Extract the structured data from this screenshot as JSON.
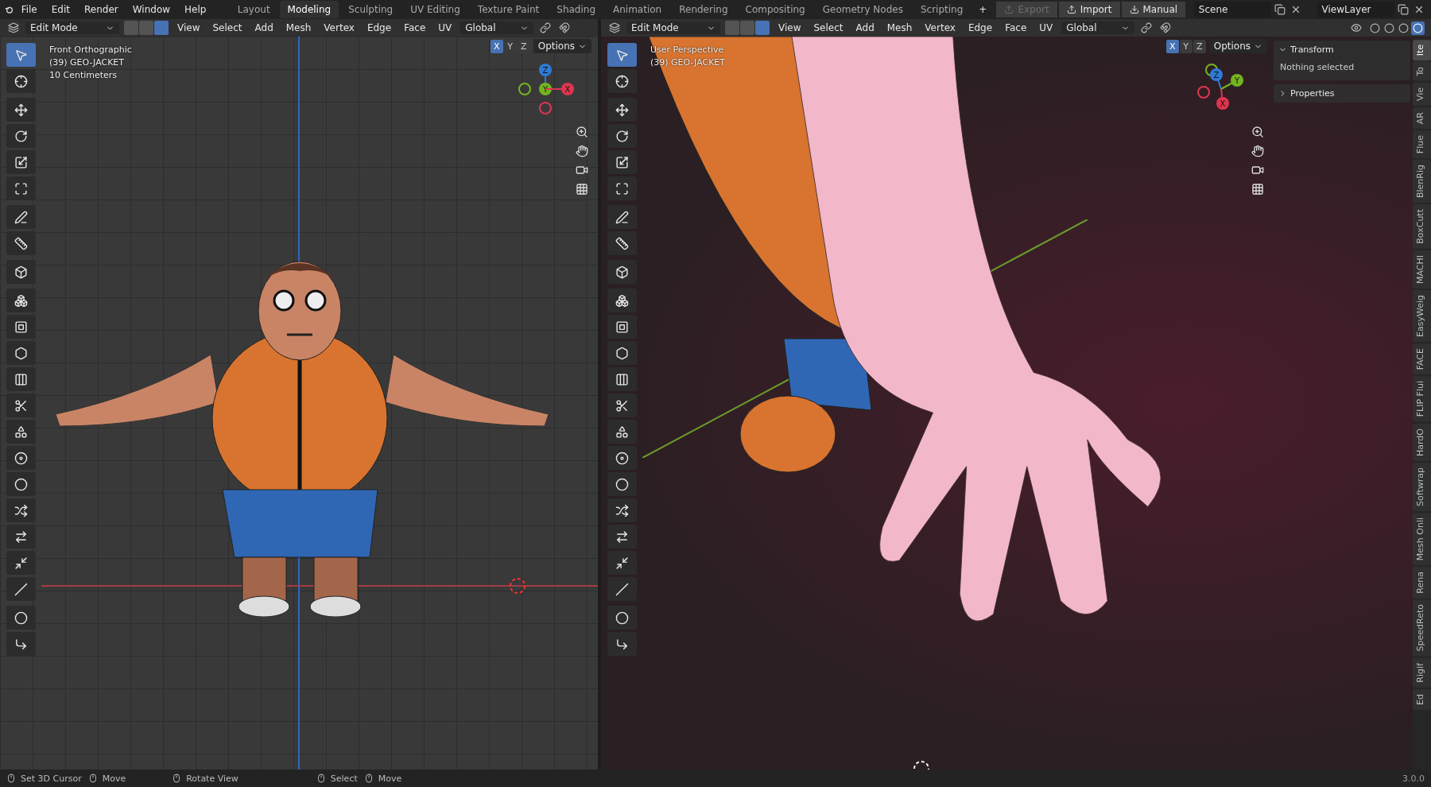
{
  "top_bar": {
    "menus": [
      "File",
      "Edit",
      "Render",
      "Window",
      "Help"
    ],
    "workspace_tabs": [
      {
        "label": "Layout",
        "selected": false
      },
      {
        "label": "Modeling",
        "selected": true
      },
      {
        "label": "Sculpting",
        "selected": false
      },
      {
        "label": "UV Editing",
        "selected": false
      },
      {
        "label": "Texture Paint",
        "selected": false
      },
      {
        "label": "Shading",
        "selected": false
      },
      {
        "label": "Animation",
        "selected": false
      },
      {
        "label": "Rendering",
        "selected": false
      },
      {
        "label": "Compositing",
        "selected": false
      },
      {
        "label": "Geometry Nodes",
        "selected": false
      },
      {
        "label": "Scripting",
        "selected": false
      }
    ],
    "add_tab": "+",
    "buttons": [
      {
        "label": "Export",
        "disabled": true
      },
      {
        "label": "Import",
        "disabled": false
      },
      {
        "label": "Manual",
        "disabled": false
      }
    ],
    "scene": "Scene",
    "view_layer": "ViewLayer"
  },
  "viewports": [
    {
      "header": {
        "mode": "Edit Mode",
        "select_modes": [
          {
            "selected": false
          },
          {
            "selected": false
          },
          {
            "selected": true
          }
        ],
        "menus": [
          "View",
          "Select",
          "Add",
          "Mesh",
          "Vertex",
          "Edge",
          "Face",
          "UV"
        ],
        "orientation": "Global",
        "axes": [
          {
            "label": "X",
            "selected": true
          },
          {
            "label": "Y",
            "selected": false
          },
          {
            "label": "Z",
            "selected": false
          }
        ],
        "options": "Options"
      },
      "overlay_lines": [
        "Front Orthographic",
        "(39) GEO-JACKET",
        "10 Centimeters"
      ],
      "gizmo": {
        "axes": [
          {
            "label": "Z",
            "color": "#2e7bd6"
          },
          {
            "label": "Y",
            "color": "#74b51f"
          },
          {
            "label": "X",
            "color": "#e0354f"
          }
        ]
      },
      "toolbar": [
        {
          "tools": [
            {
              "kind": "select",
              "selected": true
            },
            {
              "kind": "cursor",
              "selected": false
            }
          ]
        },
        {
          "tools": [
            {
              "kind": "move",
              "selected": false
            },
            {
              "kind": "rotate",
              "selected": false
            },
            {
              "kind": "scale",
              "selected": false
            },
            {
              "kind": "transform",
              "selected": false
            }
          ]
        },
        {
          "tools": [
            {
              "kind": "annotate",
              "selected": false
            },
            {
              "kind": "measure",
              "selected": false
            }
          ]
        },
        {
          "tools": [
            {
              "kind": "add_cube",
              "selected": false
            }
          ]
        },
        {
          "tools": [
            {
              "kind": "extrude",
              "selected": false
            },
            {
              "kind": "inset",
              "selected": false
            },
            {
              "kind": "bevel",
              "selected": false
            },
            {
              "kind": "loop_cut",
              "selected": false
            },
            {
              "kind": "knife",
              "selected": false
            },
            {
              "kind": "poly_build",
              "selected": false
            },
            {
              "kind": "spin",
              "selected": false
            },
            {
              "kind": "smooth",
              "selected": false
            },
            {
              "kind": "randomize",
              "selected": false
            },
            {
              "kind": "edge_slide",
              "selected": false
            },
            {
              "kind": "shrink",
              "selected": false
            },
            {
              "kind": "shear",
              "selected": false
            }
          ]
        },
        {
          "tools": [
            {
              "kind": "to_sphere",
              "selected": false
            },
            {
              "kind": "rip",
              "selected": false
            }
          ]
        }
      ]
    },
    {
      "header": {
        "mode": "Edit Mode",
        "select_modes": [
          {
            "selected": false
          },
          {
            "selected": false
          },
          {
            "selected": true
          }
        ],
        "menus": [
          "View",
          "Select",
          "Add",
          "Mesh",
          "Vertex",
          "Edge",
          "Face",
          "UV"
        ],
        "orientation": "Global",
        "axes": [
          {
            "label": "X",
            "selected": true
          },
          {
            "label": "Y",
            "selected": false
          },
          {
            "label": "Z",
            "selected": false
          }
        ],
        "options": "Options",
        "shading": [
          {
            "selected": false
          },
          {
            "selected": false
          },
          {
            "selected": false
          },
          {
            "selected": true
          }
        ]
      },
      "overlay_lines": [
        "User Perspective",
        "(39) GEO-JACKET"
      ],
      "gizmo": {
        "axes": [
          {
            "label": "Z",
            "color": "#2e7bd6"
          },
          {
            "label": "Y",
            "color": "#74b51f"
          },
          {
            "label": "X",
            "color": "#e0354f"
          }
        ]
      },
      "toolbar": [
        {
          "tools": [
            {
              "kind": "select",
              "selected": true
            },
            {
              "kind": "cursor",
              "selected": false
            }
          ]
        },
        {
          "tools": [
            {
              "kind": "move",
              "selected": false
            },
            {
              "kind": "rotate",
              "selected": false
            },
            {
              "kind": "scale",
              "selected": false
            },
            {
              "kind": "transform",
              "selected": false
            }
          ]
        },
        {
          "tools": [
            {
              "kind": "annotate",
              "selected": false
            },
            {
              "kind": "measure",
              "selected": false
            }
          ]
        },
        {
          "tools": [
            {
              "kind": "add_cube",
              "selected": false
            }
          ]
        },
        {
          "tools": [
            {
              "kind": "extrude",
              "selected": false
            },
            {
              "kind": "inset",
              "selected": false
            },
            {
              "kind": "bevel",
              "selected": false
            },
            {
              "kind": "loop_cut",
              "selected": false
            },
            {
              "kind": "knife",
              "selected": false
            },
            {
              "kind": "poly_build",
              "selected": false
            },
            {
              "kind": "spin",
              "selected": false
            },
            {
              "kind": "smooth",
              "selected": false
            },
            {
              "kind": "randomize",
              "selected": false
            },
            {
              "kind": "edge_slide",
              "selected": false
            },
            {
              "kind": "shrink",
              "selected": false
            },
            {
              "kind": "shear",
              "selected": false
            }
          ]
        },
        {
          "tools": [
            {
              "kind": "to_sphere",
              "selected": false
            },
            {
              "kind": "rip",
              "selected": false
            }
          ]
        }
      ],
      "sidebar": {
        "panels": [
          {
            "title": "Transform",
            "expanded": true,
            "body": "Nothing selected"
          },
          {
            "title": "Properties",
            "expanded": false
          }
        ],
        "tabs": [
          {
            "label": "Ite",
            "selected": true
          },
          {
            "label": "To",
            "selected": false
          },
          {
            "label": "Vie",
            "selected": false
          },
          {
            "label": "AR",
            "selected": false
          },
          {
            "label": "Flue",
            "selected": false
          },
          {
            "label": "BlenRig",
            "selected": false
          },
          {
            "label": "BoxCutt",
            "selected": false
          },
          {
            "label": "MACHI",
            "selected": false
          },
          {
            "label": "EasyWeig",
            "selected": false
          },
          {
            "label": "FACE",
            "selected": false
          },
          {
            "label": "FLIP Flui",
            "selected": false
          },
          {
            "label": "HardO",
            "selected": false
          },
          {
            "label": "Softwrap",
            "selected": false
          },
          {
            "label": "Mesh Onli",
            "selected": false
          },
          {
            "label": "Rena",
            "selected": false
          },
          {
            "label": "SpeedReto",
            "selected": false
          },
          {
            "label": "Rigif",
            "selected": false
          },
          {
            "label": "Ed",
            "selected": false
          }
        ]
      }
    }
  ],
  "status_bar": {
    "hints": [
      {
        "label": "Set 3D Cursor"
      },
      {
        "label": "Move"
      },
      {
        "label": "Rotate View"
      },
      {
        "label": "Select"
      },
      {
        "label": "Move"
      }
    ],
    "version": "3.0.0"
  }
}
